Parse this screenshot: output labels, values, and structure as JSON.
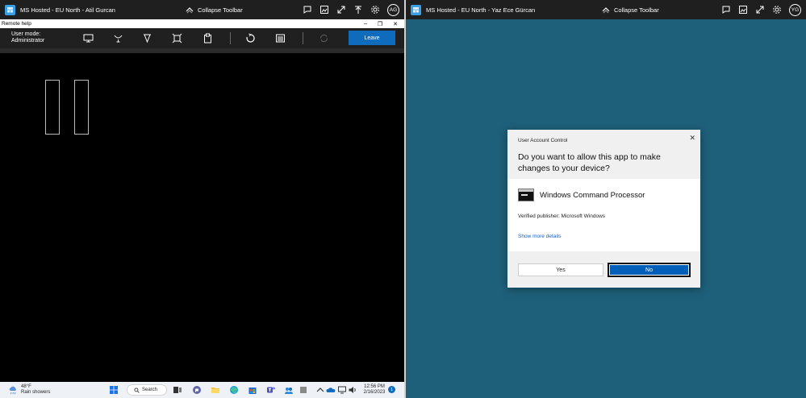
{
  "left_session": {
    "title": "MS Hosted - EU North - Atil Gurcan",
    "collapse_label": "Collapse Toolbar",
    "avatar_initials": "AG",
    "remote_help": {
      "window_title": "Remote help",
      "minimize": "–",
      "restore": "❐",
      "close": "✕",
      "user_mode_label": "User mode:",
      "user_mode_value": "Administrator",
      "leave_label": "Leave"
    },
    "taskbar": {
      "temperature": "48°F",
      "weather": "Rain showers",
      "search_label": "Search",
      "time": "12:56 PM",
      "date": "2/16/2023",
      "notification_count": "1"
    }
  },
  "right_session": {
    "title": "MS Hosted - EU North - Yaz Ece Gürcan",
    "collapse_label": "Collapse Toolbar",
    "avatar_initials": "YG",
    "uac": {
      "header": "User Account Control",
      "close": "✕",
      "question": "Do you want to allow this app to make changes to your device?",
      "app_name": "Windows Command Processor",
      "publisher": "Verified publisher: Microsoft Windows",
      "show_more": "Show more details",
      "yes_label": "Yes",
      "no_label": "No"
    }
  },
  "colors": {
    "accent": "#0f6cbd",
    "desktop": "#1e5f79",
    "toolbar": "#1f1f1f"
  }
}
